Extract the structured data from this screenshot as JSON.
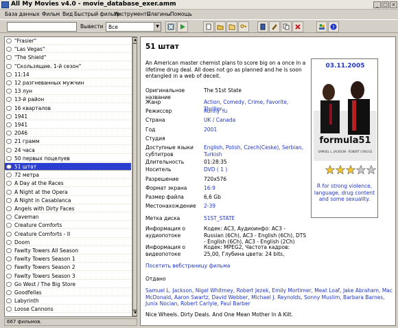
{
  "window": {
    "title": "All My Movies v4.0 - movie_database_exer.amm"
  },
  "menu": [
    "База данных",
    "Фильм",
    "Вид",
    "Быстрый фильтр",
    "Инструменты",
    "Плагины",
    "Помощь"
  ],
  "toolbar": {
    "search_value": "",
    "apply_label": "Вывести",
    "filter_value": "Все"
  },
  "movies": [
    "\"Frasier\"",
    "\"Las Vegas\"",
    "\"The Shield\"",
    "\"Скользящие. 1-й сезон\"",
    "11:14",
    "12 разгневанных мужчин",
    "13 лун",
    "13-й район",
    "16 кварталов",
    "1941",
    "1941",
    "2046",
    "21 грамм",
    "24 часа",
    "50 первых поцелуев",
    "51 штат",
    "72 метра",
    "A Day at the Races",
    "A Night at the Opera",
    "A Night in Casablanca",
    "Angels with Dirty Faces",
    "Caveman",
    "Creature Comforts",
    "Creature Comforts - II",
    "Doom",
    "Fawlty Towers All Season",
    "Fawlty Towers Season 1",
    "Fawlty Towers Season 2",
    "Fawlty Towers Season 3",
    "Go West / The Big Store",
    "Goodfellas",
    "Labyrinth",
    "Loose Cannons"
  ],
  "selected_index": 15,
  "status": {
    "count_text": "667 фильмов."
  },
  "detail": {
    "title": "51 штат",
    "plot": "An American master chemist plans to score big on a once in a lifetime drug deal. All does not go as planned and he is soon entangled in a web of deceit.",
    "fields": [
      {
        "label": "Оригинальное название",
        "value": "The 51st State",
        "link": false
      },
      {
        "label": "Жанр",
        "value": "Action, Comedy, Crime, Favorite, Thriller",
        "link": true
      },
      {
        "label": "Режиссер",
        "value": "Ronny Yu",
        "link": true
      },
      {
        "label": "Страна",
        "value": "UK / Canada",
        "link": true
      },
      {
        "label": "Год",
        "value": "2001",
        "link": true
      },
      {
        "label": "Студия",
        "value": "",
        "link": false
      },
      {
        "label": "Доступные языки субтитров",
        "value": "English, Polish, Czech(Ceske), Serbian, Turkish",
        "link": true
      },
      {
        "label": "Длительность",
        "value": "01:28:35",
        "link": false
      },
      {
        "label": "Носитель",
        "value": "DVD ( 1 )",
        "link": true
      },
      {
        "label": "Разрешение",
        "value": "720x576",
        "link": false
      },
      {
        "label": "Формат экрана",
        "value": "16:9",
        "link": true
      },
      {
        "label": "Размер файла",
        "value": "6,6 Gb",
        "link": false
      },
      {
        "label": "Местонахождение",
        "value": "2-39",
        "link": true
      },
      {
        "label": "Метка диска",
        "value": "51ST_STATE",
        "link": true
      },
      {
        "label": "Информация о аудиопотоке",
        "value": "Кодек: AC3, Аудиоинфо: AC3 - Russian (6Ch), AC3 - English (6Ch), DTS - English (6Ch), AC3 - English (2Ch)",
        "link": false
      },
      {
        "label": "Информация о видеопотоке",
        "value": "Кодек: MPEG2, Частота кадров: 25,00, Глубина цвета: 24 bits,",
        "link": false
      }
    ],
    "web_link": "Посетить вебстраницу фильма",
    "cast_label": "Отдано",
    "cast": "Samuel L. Jackson, Nigel Whitmey, Robert Jezek, Emily Mortimer, Meat Loaf, Jake Abraham, Mac McDonald, Aaron Swartz, David Webber, Michael J. Reynolds, Sonny Muslim, Barbara Barnes, Junix Nocian, Robert Carlyle, Paul Barber",
    "tagline": "Nice Wheels. Dirty Deals. And One Mean Mother In A Kilt.",
    "poster": {
      "date": "03.11.2005",
      "caption": "formula51",
      "small_names": "SAMUEL L. JACKSON · ROBERT CARLYLE"
    },
    "rating": {
      "value": 3,
      "max": 5
    },
    "mpaa": "R for strong violence, language, drug content and some sexuality."
  },
  "colors": {
    "selection": "#2a3fd2",
    "link": "#1f35c7",
    "star": "#f4c430"
  },
  "icons": [
    "app-icon",
    "clear-icon",
    "go-icon",
    "new-icon",
    "open-icon",
    "save-icon",
    "key-icon",
    "book-icon",
    "edit-icon",
    "copy-icon",
    "delete-icon",
    "people-icon",
    "help-icon"
  ]
}
